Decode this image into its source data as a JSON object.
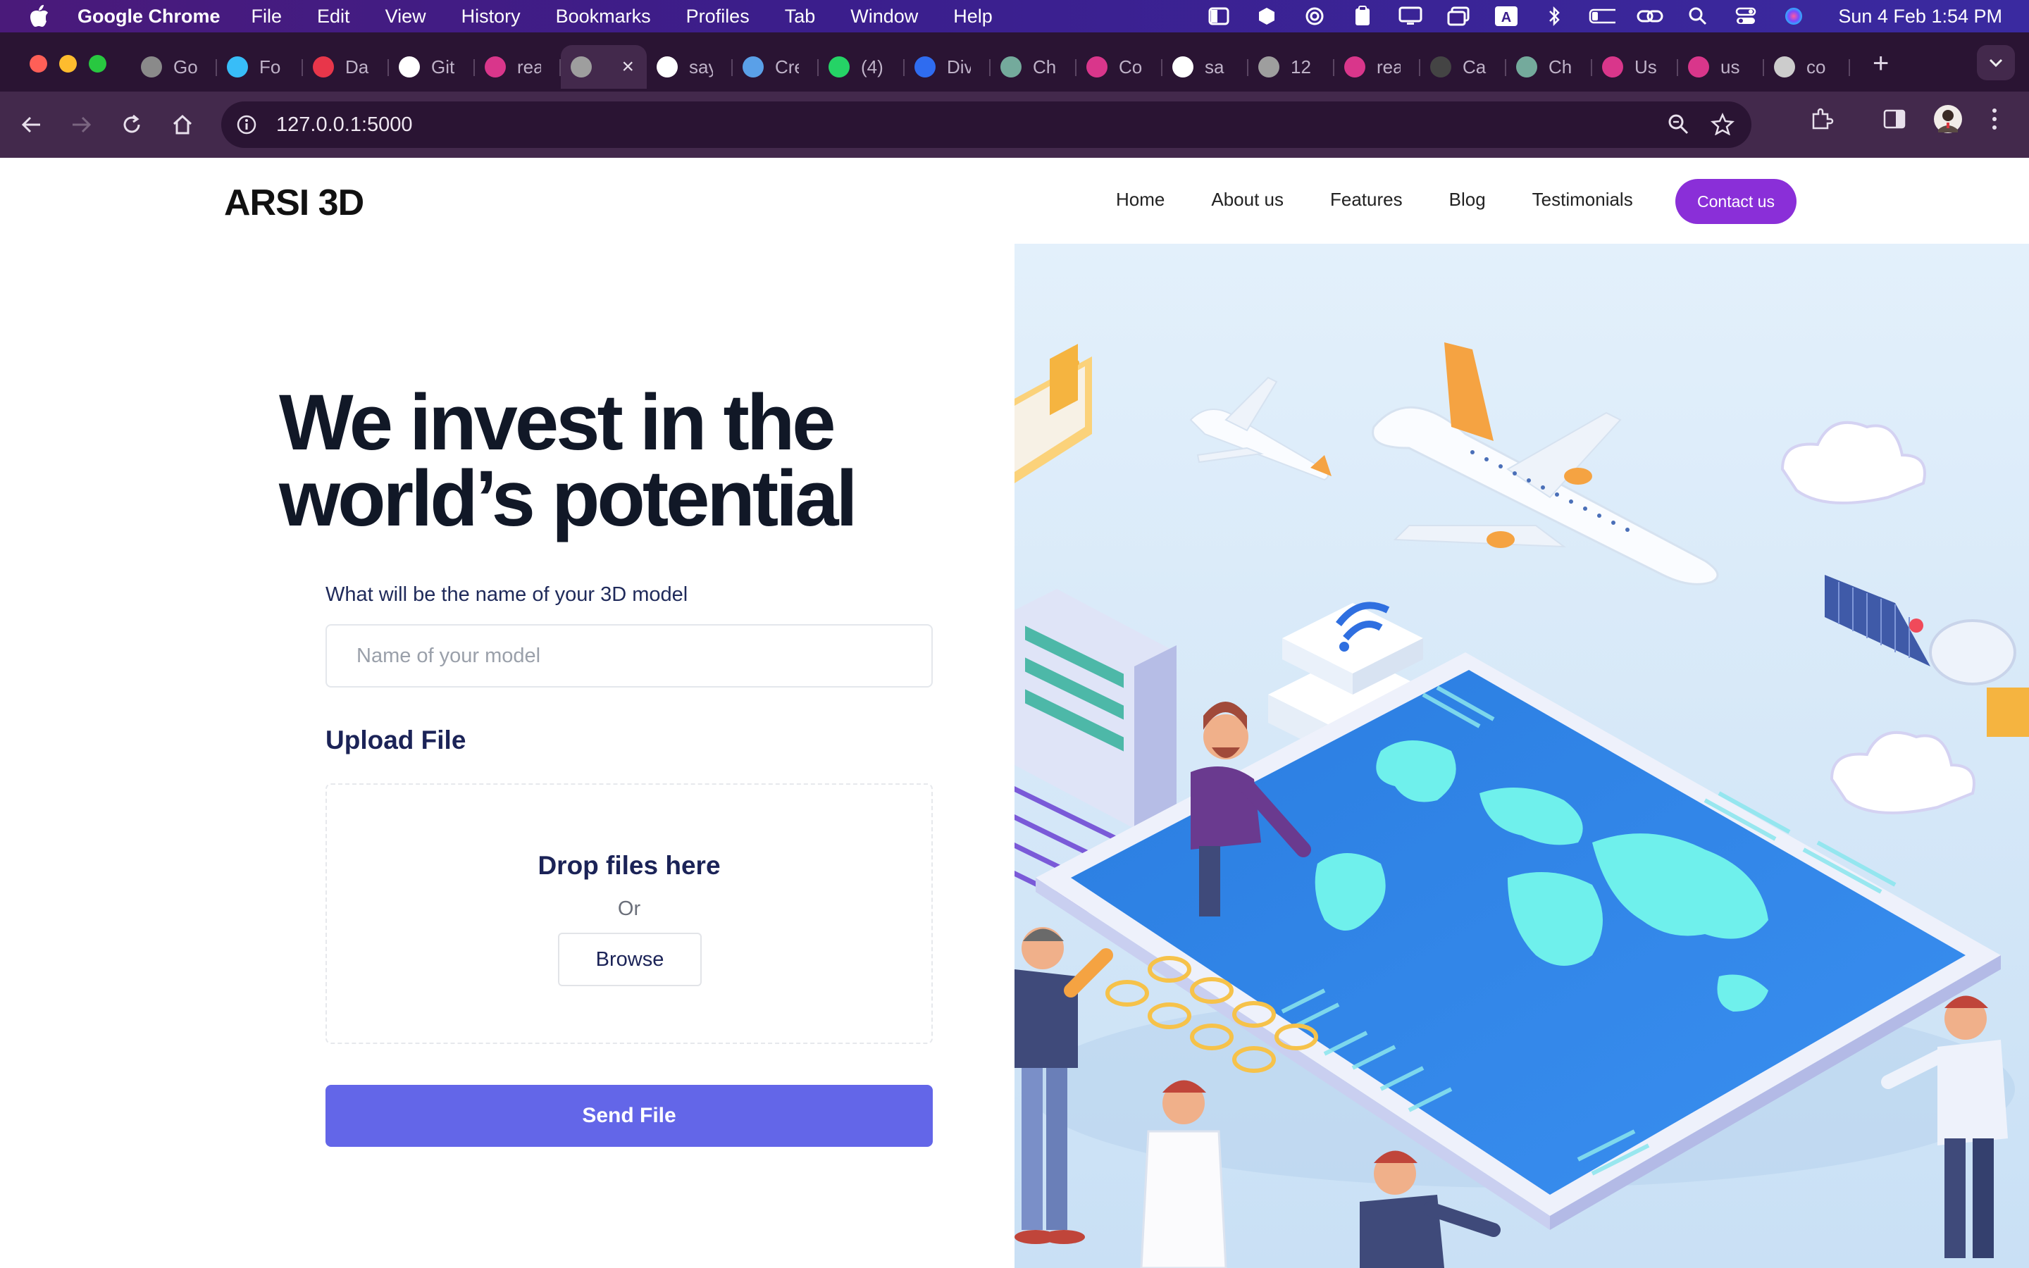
{
  "os_menubar": {
    "app_name": "Google Chrome",
    "menus": [
      "File",
      "Edit",
      "View",
      "History",
      "Bookmarks",
      "Profiles",
      "Tab",
      "Window",
      "Help"
    ],
    "clock": "Sun 4 Feb  1:54 PM"
  },
  "browser": {
    "tabs": [
      {
        "label": "Go",
        "icon": "chrome-icon",
        "color": "#8a8a8a"
      },
      {
        "label": "Fo",
        "icon": "tailwind-icon",
        "color": "#38bdf8"
      },
      {
        "label": "Da",
        "icon": "dashboard-icon",
        "color": "#e8364a"
      },
      {
        "label": "Git",
        "icon": "github-icon",
        "color": "#ffffff"
      },
      {
        "label": "rea",
        "icon": "webflow-icon",
        "color": "#d9368b"
      },
      {
        "label": "",
        "icon": "globe-icon",
        "color": "#9e9e9e",
        "active": true
      },
      {
        "label": "say",
        "icon": "github-icon",
        "color": "#ffffff"
      },
      {
        "label": "Cre",
        "icon": "tool-icon",
        "color": "#5aa0e8"
      },
      {
        "label": "(4)",
        "icon": "whatsapp-icon",
        "color": "#25d366"
      },
      {
        "label": "Div",
        "icon": "docs-icon",
        "color": "#2f6cf0"
      },
      {
        "label": "Ch",
        "icon": "openai-icon",
        "color": "#74aa9c"
      },
      {
        "label": "Co",
        "icon": "webflow-icon",
        "color": "#d9368b"
      },
      {
        "label": "sa",
        "icon": "github-icon",
        "color": "#ffffff"
      },
      {
        "label": "12",
        "icon": "globe-icon",
        "color": "#9e9e9e"
      },
      {
        "label": "rea",
        "icon": "webflow-icon",
        "color": "#d9368b"
      },
      {
        "label": "Ca",
        "icon": "cutter-icon",
        "color": "#444444"
      },
      {
        "label": "Ch",
        "icon": "openai-icon",
        "color": "#74aa9c"
      },
      {
        "label": "Us",
        "icon": "webflow-icon",
        "color": "#d9368b"
      },
      {
        "label": "us",
        "icon": "webflow-icon",
        "color": "#d9368b"
      },
      {
        "label": "co",
        "icon": "loading-icon",
        "color": "#cccccc"
      }
    ],
    "url": "127.0.0.1:5000"
  },
  "site": {
    "brand": "ARSI 3D",
    "nav": [
      "Home",
      "About us",
      "Features",
      "Blog",
      "Testimonials"
    ],
    "contact_label": "Contact us",
    "hero_line1": "We invest in the",
    "hero_line2": "world’s potential",
    "model_name_label": "What will be the name of your 3D model",
    "model_name_placeholder": "Name of your model",
    "upload_title": "Upload File",
    "drop_text": "Drop files here",
    "or_text": "Or",
    "browse_label": "Browse",
    "send_label": "Send File",
    "accent_color": "#8a2fd8",
    "primary_button_color": "#6366e8"
  }
}
